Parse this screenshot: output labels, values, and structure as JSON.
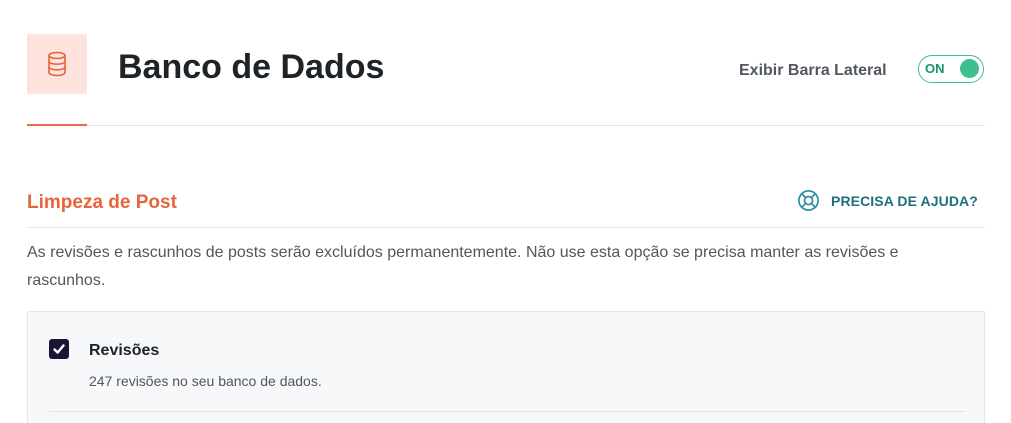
{
  "header": {
    "title": "Banco de Dados",
    "icon": "database-icon",
    "sidebar_toggle": {
      "label": "Exibir Barra Lateral",
      "state_text": "ON",
      "enabled": true
    }
  },
  "section": {
    "title": "Limpeza de Post",
    "help": {
      "label": "PRECISA DE AJUDA?",
      "icon": "lifebuoy-icon"
    },
    "description": "As revisões e rascunhos de posts serão excluídos permanentemente. Não use esta opção se precisa manter as revisões e rascunhos.",
    "options": [
      {
        "title": "Revisões",
        "description": "247 revisões no seu banco de dados.",
        "checked": true
      }
    ]
  },
  "colors": {
    "accent": "#e8643c",
    "icon_bg": "#fde3dc",
    "toggle_on": "#3cc08f",
    "help_link": "#1e6f7e",
    "checkbox": "#1c1433"
  }
}
